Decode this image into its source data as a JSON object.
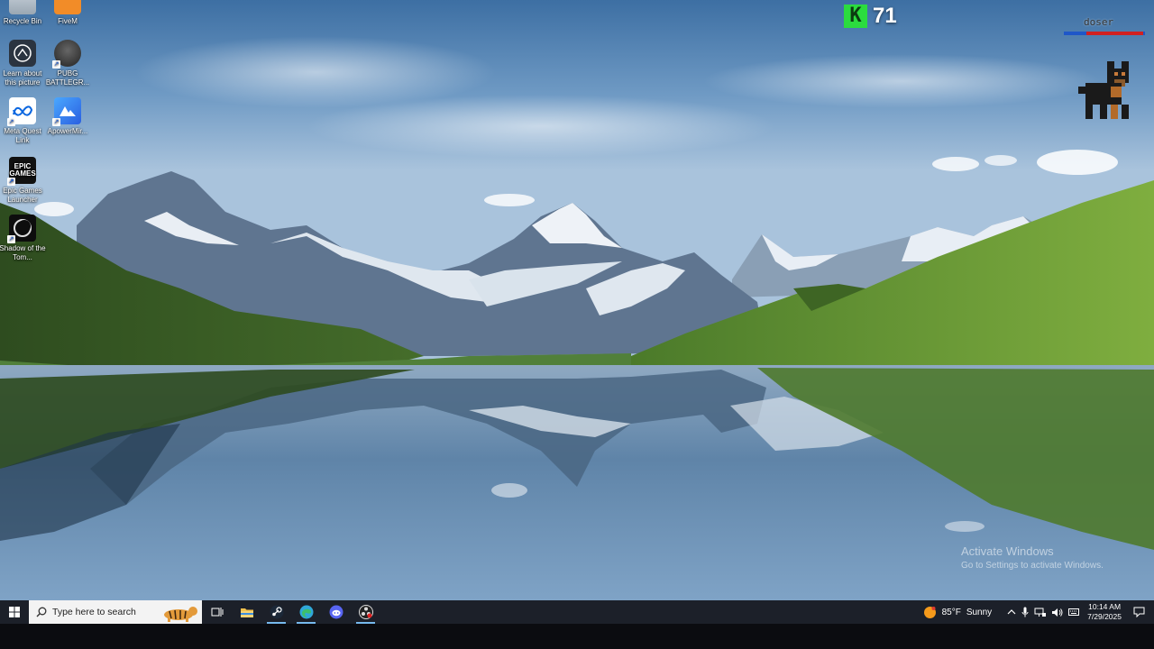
{
  "desktop": {
    "icons": [
      {
        "label": "Recycle Bin"
      },
      {
        "label": "FiveM"
      },
      {
        "label": "Learn about this picture"
      },
      {
        "label": "PUBG BATTLEGR..."
      },
      {
        "label": "Meta Quest Link"
      },
      {
        "label": "ApowerMir..."
      },
      {
        "label": "Epic Games Launcher"
      },
      {
        "label": "Shadow of the Tom..."
      }
    ]
  },
  "overlay": {
    "k_counter": {
      "badge": "K",
      "value": "71",
      "badge_color": "#2bdc3e"
    },
    "pet": {
      "name": "doser",
      "health_fraction": 0.7
    }
  },
  "watermark": {
    "title": "Activate Windows",
    "subtitle": "Go to Settings to activate Windows."
  },
  "taskbar": {
    "search_placeholder": "Type here to search",
    "apps": [
      "task-view",
      "file-explorer",
      "steam",
      "edge",
      "discord",
      "obs"
    ],
    "weather": {
      "temp": "85°F",
      "condition": "Sunny"
    },
    "clock": {
      "time": "10:14 AM",
      "date": "7/29/2025"
    }
  }
}
